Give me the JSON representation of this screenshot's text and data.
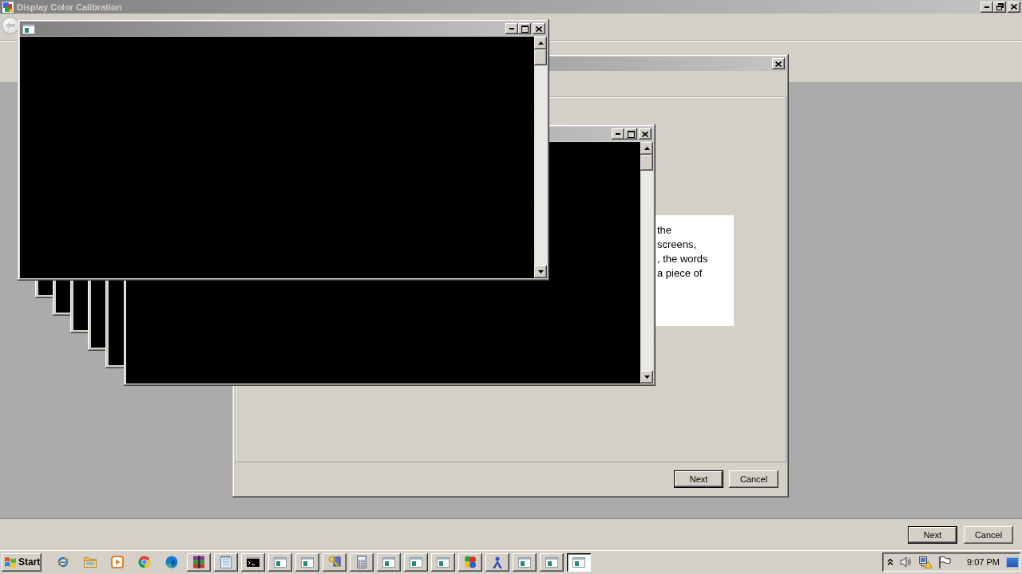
{
  "app_window": {
    "title": "Display Color Calibration",
    "buttons": [
      {
        "label": "Next",
        "default": true
      },
      {
        "label": "Cancel",
        "default": false
      }
    ]
  },
  "dialog": {
    "text_lines": [
      "the",
      "screens,",
      ", the words",
      "a piece of"
    ],
    "buttons": [
      {
        "label": "Next",
        "default": true
      },
      {
        "label": "Cancel",
        "default": false
      }
    ]
  },
  "taskbar": {
    "start_label": "Start",
    "task_buttons": [
      {
        "selected": false
      },
      {
        "selected": false
      },
      {
        "selected": false
      },
      {
        "selected": false
      },
      {
        "selected": false
      },
      {
        "selected": false
      },
      {
        "selected": false
      },
      {
        "selected": false
      },
      {
        "selected": false
      },
      {
        "selected": false
      },
      {
        "selected": false
      },
      {
        "selected": false
      },
      {
        "selected": false
      },
      {
        "selected": false
      },
      {
        "selected": true
      }
    ],
    "clock": "9:07 PM"
  }
}
